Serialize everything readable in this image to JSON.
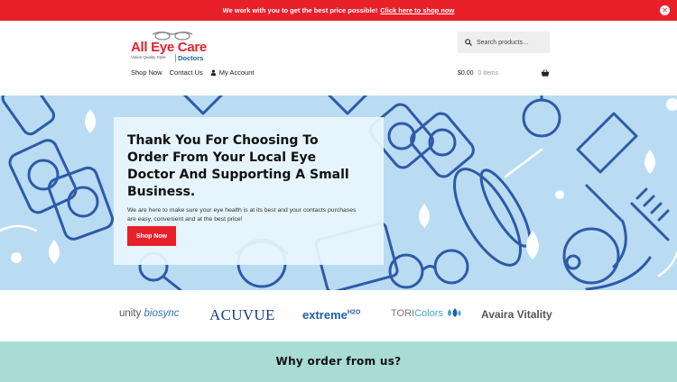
{
  "announcement": {
    "text": "We work with you to get the best price possible!",
    "link_text": "Click here to shop now",
    "close_glyph": "✕"
  },
  "logo": {
    "brand": "All Eye Care",
    "tagline": "Vision Quality Style",
    "subbrand": "Doctors"
  },
  "nav": {
    "items": [
      "Shop Now",
      "Contact Us",
      "My Account"
    ]
  },
  "search": {
    "placeholder": "Search products…"
  },
  "cart": {
    "total": "$0.00",
    "count": "0 items"
  },
  "hero": {
    "heading": "Thank You For Choosing To Order From Your Local Eye Doctor And Supporting A Small Business.",
    "body": "We are here to make sure your eye health is at its best and your contacts purchases are easy, convenient and at the best price!",
    "button": "Shop Now"
  },
  "brands": {
    "unity_prefix": "unity",
    "unity_suffix": "biosync",
    "acuvue": "ACUVUE",
    "extreme": "extreme",
    "extreme_sup": "H2O",
    "tori_prefix": "TORI",
    "tori_suffix": "Colors",
    "avaira": "Avaira Vitality"
  },
  "why": {
    "heading": "Why order from us?"
  },
  "colors": {
    "accent_red": "#e8202a",
    "hero_bg": "#b9dcf3",
    "why_bg": "#a8dcd4",
    "brand_blue": "#1f5fa8"
  }
}
